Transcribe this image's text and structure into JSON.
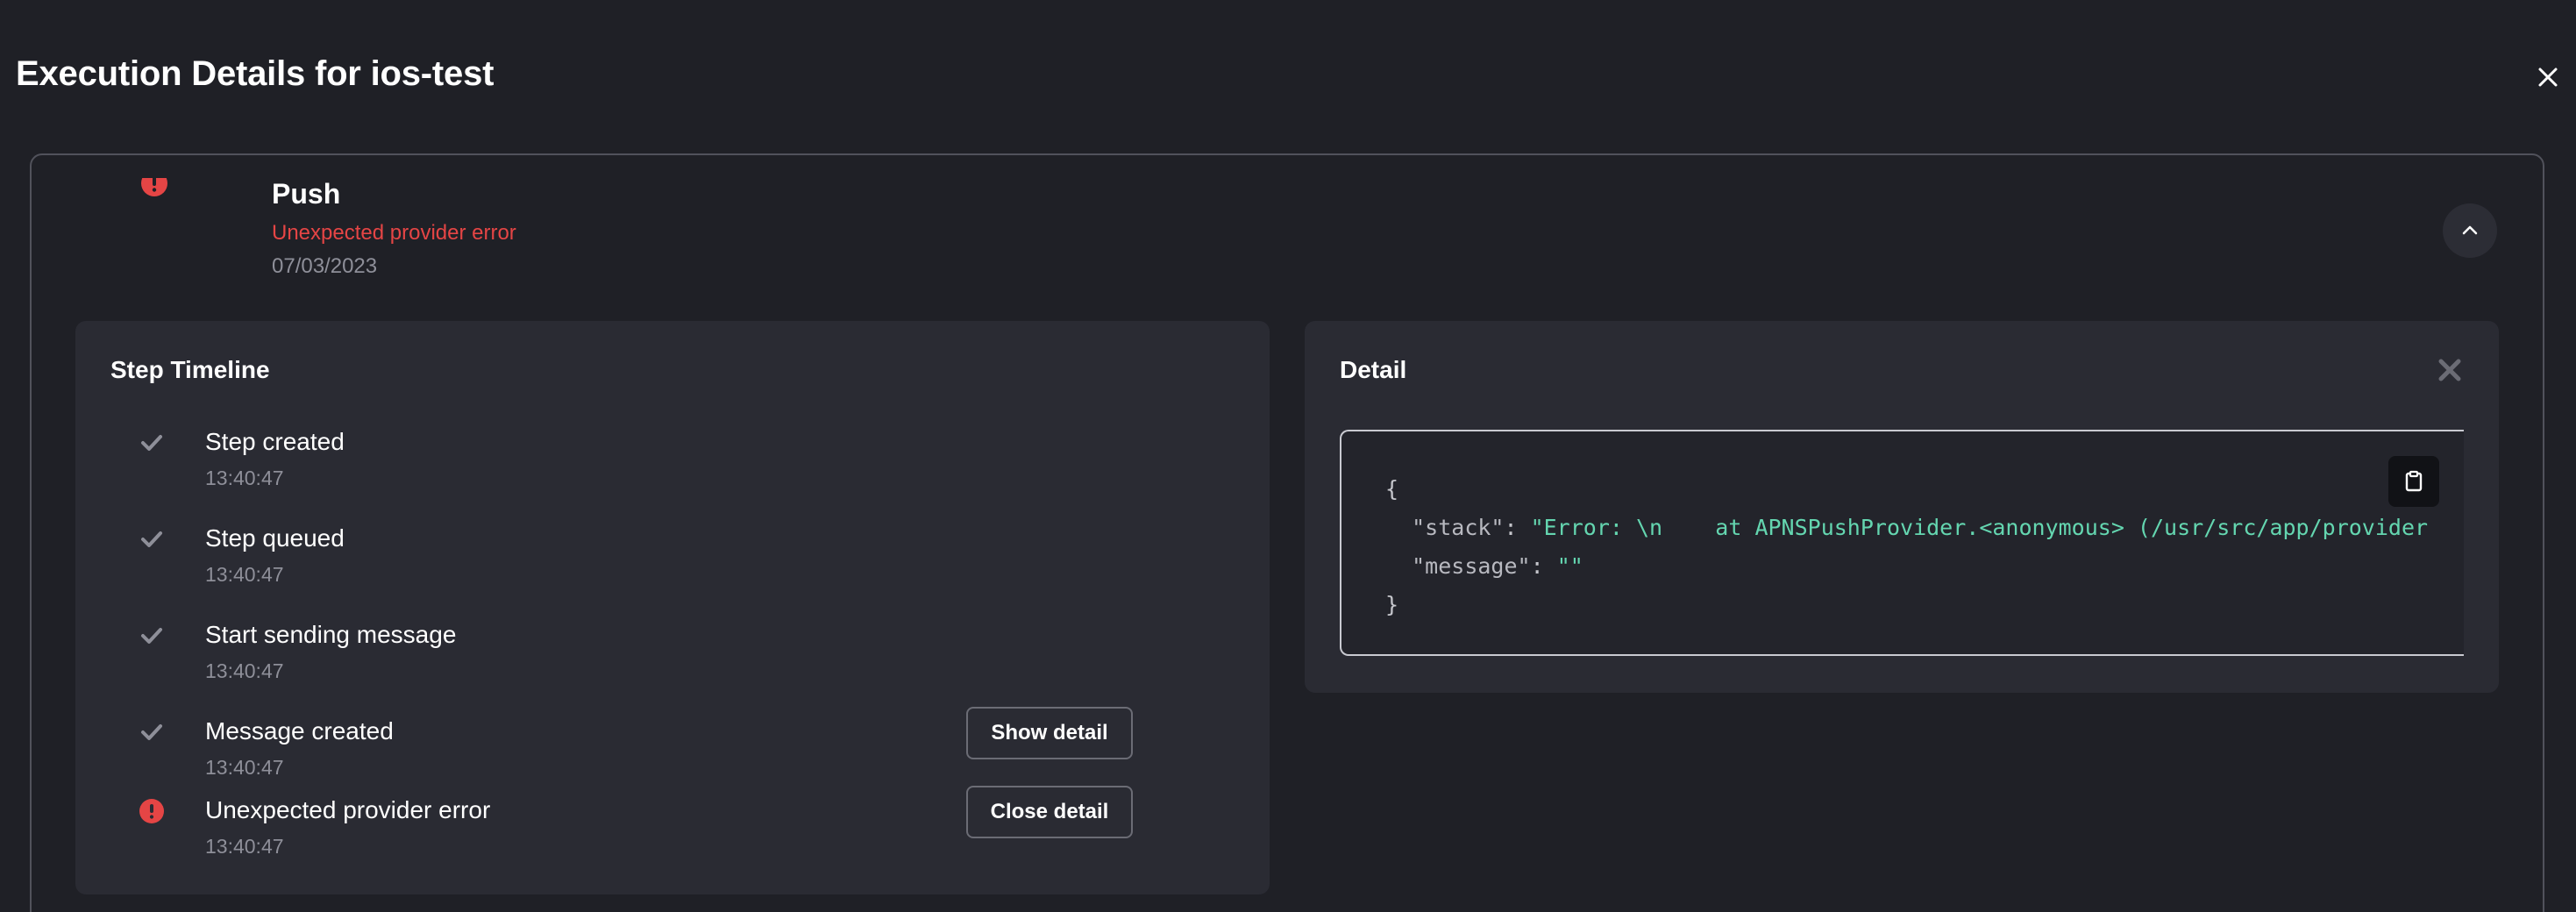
{
  "modal": {
    "title": "Execution Details for ios-test"
  },
  "step": {
    "name": "Push",
    "error": "Unexpected provider error",
    "date": "07/03/2023"
  },
  "timeline": {
    "title": "Step Timeline",
    "items": [
      {
        "label": "Step created",
        "time": "13:40:47",
        "status": "done"
      },
      {
        "label": "Step queued",
        "time": "13:40:47",
        "status": "done"
      },
      {
        "label": "Start sending message",
        "time": "13:40:47",
        "status": "done"
      },
      {
        "label": "Message created",
        "time": "13:40:47",
        "status": "done",
        "button": "Show detail"
      },
      {
        "label": "Unexpected provider error",
        "time": "13:40:47",
        "status": "error",
        "button": "Close detail"
      }
    ]
  },
  "detail": {
    "title": "Detail",
    "code": {
      "open": "{",
      "stack_key": "\"stack\"",
      "stack_value": "\"Error: \\n    at APNSPushProvider.<anonymous> (/usr/src/app/provider",
      "message_key": "\"message\"",
      "message_value": "\"\"",
      "close": "}"
    }
  },
  "colors": {
    "background": "#1f2026",
    "panel": "#2a2b33",
    "error": "#e54545",
    "muted": "#8e8f99",
    "code_string": "#64d6b0"
  },
  "icons": {
    "close_modal": "close-icon",
    "step_status": "error-icon",
    "collapse": "chevron-up-icon",
    "done": "check-icon",
    "detail_close": "close-icon",
    "copy": "clipboard-icon"
  }
}
